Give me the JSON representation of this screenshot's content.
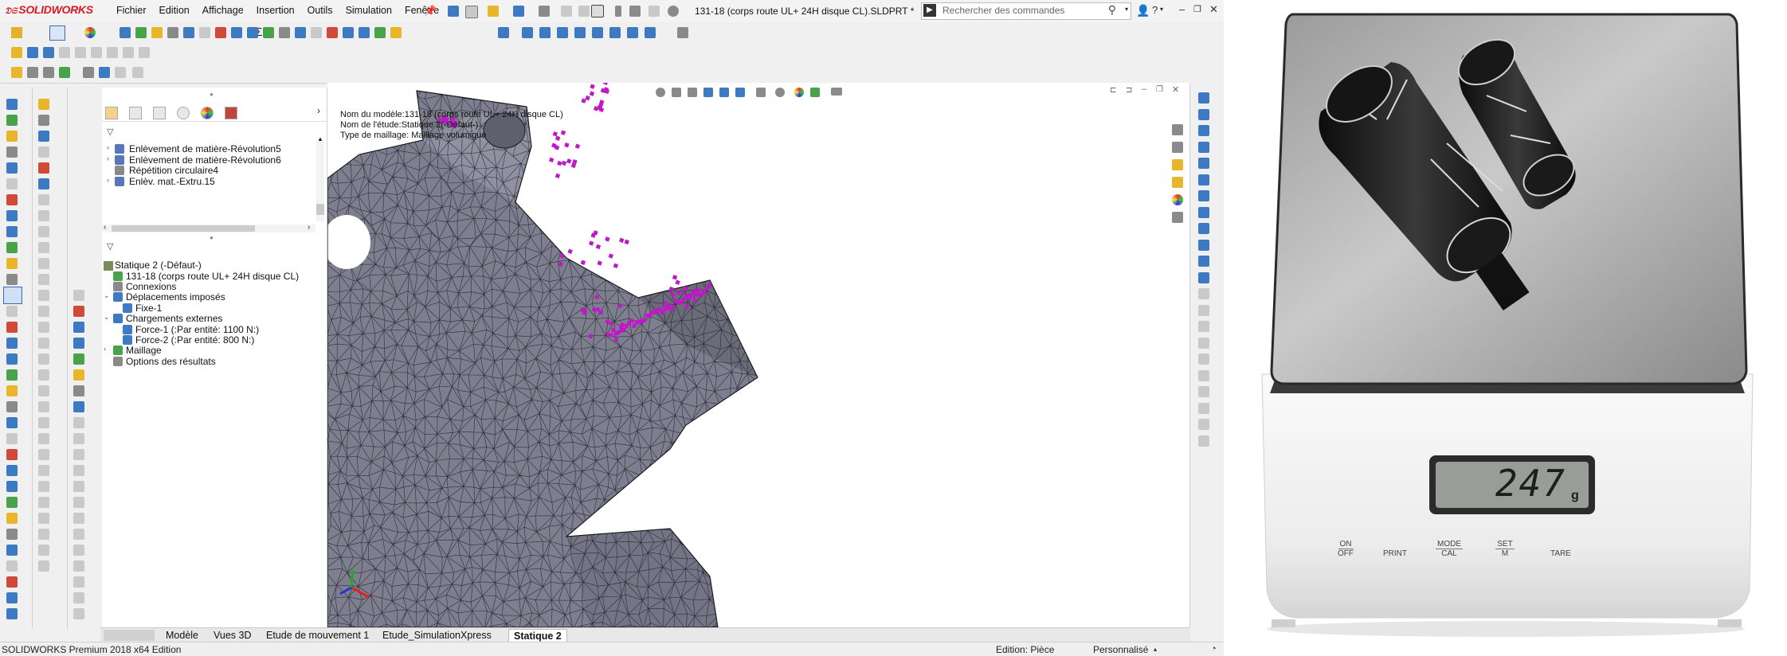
{
  "app": {
    "logo": "SOLIDWORKS",
    "document_title": "131-18 (corps route UL+ 24H disque CL).SLDPRT *",
    "search_placeholder": "Rechercher des commandes",
    "menus": [
      "Fichier",
      "Edition",
      "Affichage",
      "Insertion",
      "Outils",
      "Simulation",
      "Fenêtre",
      "?"
    ]
  },
  "feature_tree": {
    "items": [
      {
        "label": "Enlèvement de matière-Révolution5",
        "expandable": true
      },
      {
        "label": "Enlèvement de matière-Révolution6",
        "expandable": true
      },
      {
        "label": "Répétition circulaire4",
        "expandable": false
      },
      {
        "label": "Enlèv. mat.-Extru.15",
        "expandable": true
      }
    ]
  },
  "study_tree": {
    "root": "Statique 2 (-Défaut-)",
    "items": [
      {
        "label": "131-18 (corps route UL+ 24H disque CL)",
        "level": 1
      },
      {
        "label": "Connexions",
        "level": 1
      },
      {
        "label": "Déplacements imposés",
        "level": 1
      },
      {
        "label": "Fixe-1",
        "level": 2
      },
      {
        "label": "Chargements externes",
        "level": 1
      },
      {
        "label": "Force-1 (:Par entité: 1100 N:)",
        "level": 2
      },
      {
        "label": "Force-2 (:Par entité: 800 N:)",
        "level": 2
      },
      {
        "label": "Maillage",
        "level": 1
      },
      {
        "label": "Options des résultats",
        "level": 1
      }
    ]
  },
  "viewport": {
    "model_name": "Nom du modèle:131-18 (corps route UL+ 24H disque CL)",
    "study_name": "Nom de l'étude:Statique 2(-Défaut-)",
    "mesh_type": "Type de maillage: Maillage volumique"
  },
  "bottom_tabs": [
    "Modèle",
    "Vues 3D",
    "Etude de mouvement 1",
    "Etude_SimulationXpress",
    "Statique 2"
  ],
  "active_tab": "Statique 2",
  "status_bar": {
    "edition": "SOLIDWORKS Premium 2018 x64 Edition",
    "mode": "Edition: Pièce",
    "custom": "Personnalisé"
  },
  "scale": {
    "reading": "247",
    "unit": "g",
    "buttons": [
      {
        "top": "ON",
        "bottom": "OFF"
      },
      {
        "top": "PRINT",
        "bottom": ""
      },
      {
        "top": "MODE",
        "bottom": "CAL"
      },
      {
        "top": "SET",
        "bottom": "M"
      },
      {
        "top": "TARE",
        "bottom": ""
      }
    ]
  },
  "colors": {
    "mesh_fill": "#7d7f8e",
    "mesh_line": "#1c1c24",
    "marker": "#c018c8",
    "brand_red": "#d71920"
  }
}
